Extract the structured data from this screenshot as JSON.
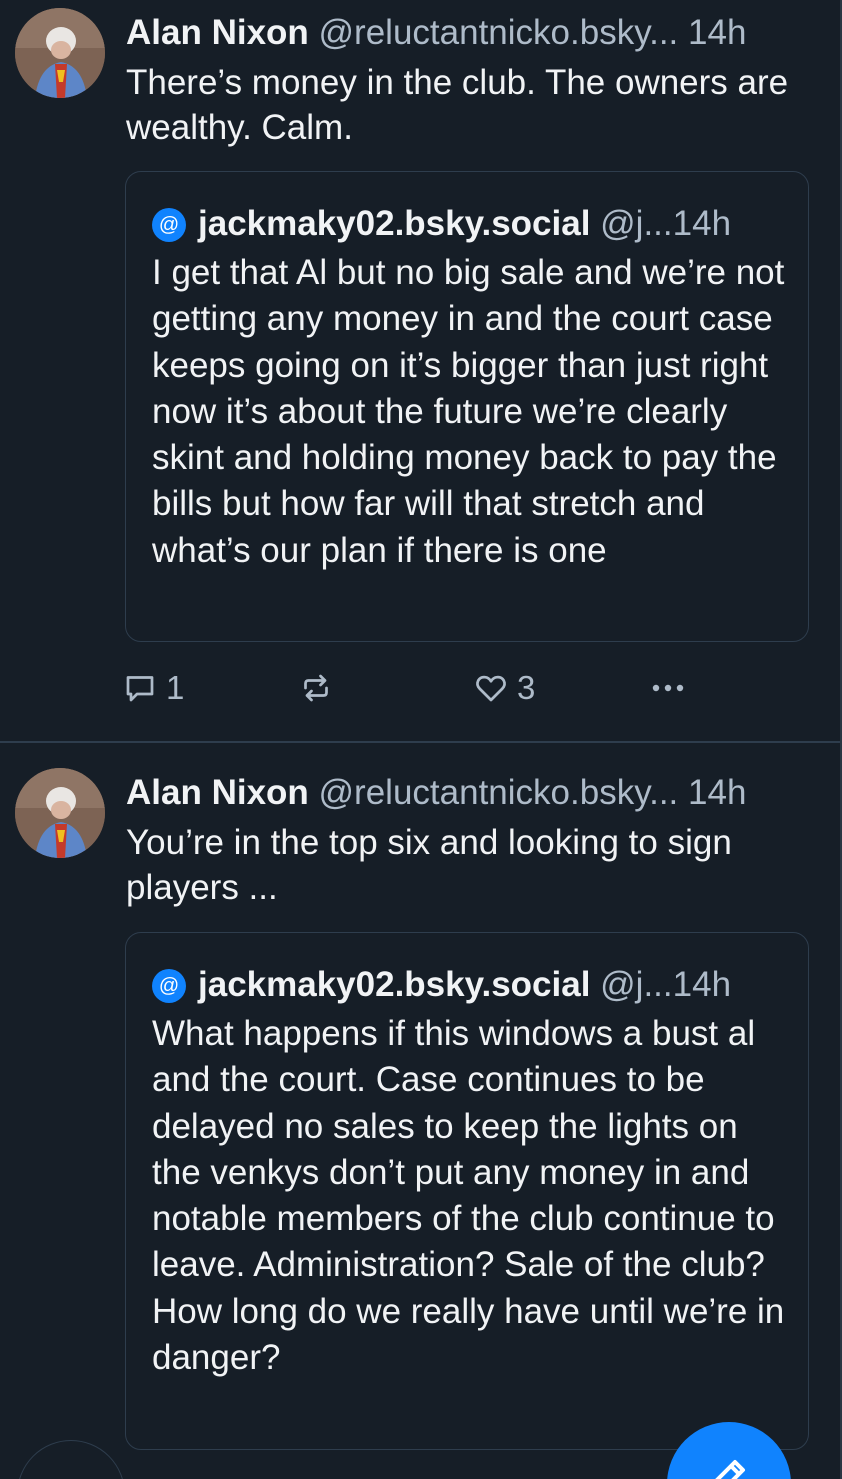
{
  "posts": [
    {
      "author": {
        "display_name": "Alan Nixon",
        "handle": "@reluctantnicko.bsky...",
        "time": "14h",
        "avatar_icon": "user-photo-avatar"
      },
      "text": "There’s money in the club. The owners are wealthy. Calm.",
      "quote": {
        "avatar_icon": "at-sign-default-avatar",
        "display_name": "jackmaky02.bsky.social",
        "handle": "@j...",
        "time": "14h",
        "text": "I get that Al but no big sale and we’re not getting any money in and the court case keeps going on it’s bigger than just right now it’s about the future we’re clearly skint and holding money back to pay the bills but how far will that stretch and what’s our plan if there is one"
      },
      "actions": {
        "reply_count": "1",
        "repost_count": "",
        "like_count": "3",
        "icons": [
          "reply-icon",
          "repost-icon",
          "like-icon",
          "more-icon"
        ]
      }
    },
    {
      "author": {
        "display_name": "Alan Nixon",
        "handle": "@reluctantnicko.bsky...",
        "time": "14h",
        "avatar_icon": "user-photo-avatar"
      },
      "text": "You’re in the top six and looking to sign players ...",
      "quote": {
        "avatar_icon": "at-sign-default-avatar",
        "display_name": "jackmaky02.bsky.social",
        "handle": "@j...",
        "time": "14h",
        "text": "What happens if this windows a bust al and the court. Case continues to be delayed no sales to keep the lights on the venkys don’t put any money in and notable members of the club continue to leave. Administration? Sale of the club? How long do we really have until we’re in danger?"
      }
    }
  ],
  "compose_button": {
    "icon": "compose-icon"
  },
  "colors": {
    "background": "#161e27",
    "text": "#f1f3f5",
    "muted": "#aebbc9",
    "border": "#2e3d4d",
    "accent": "#1083fe"
  }
}
